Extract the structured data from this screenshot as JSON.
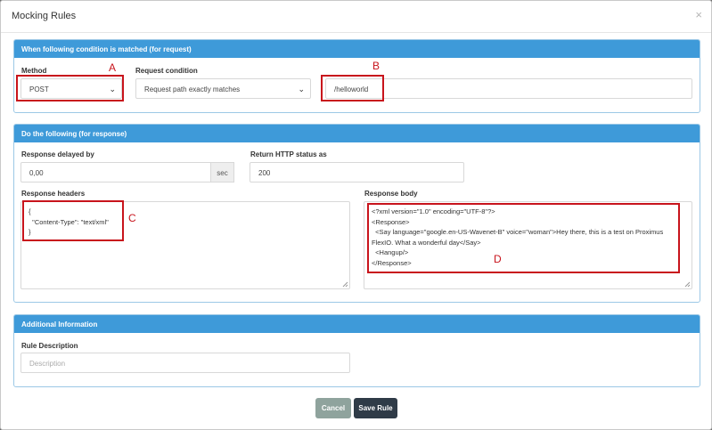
{
  "modal": {
    "title": "Mocking Rules",
    "close_glyph": "×"
  },
  "request_section": {
    "title": "When following condition is matched (for request)",
    "method_label": "Method",
    "method_value": "POST",
    "condition_label": "Request condition",
    "condition_value": "Request path exactly matches",
    "path_value": "/helloworld"
  },
  "response_section": {
    "title": "Do the following (for response)",
    "delay_label": "Response delayed by",
    "delay_value": "0,00",
    "delay_unit": "sec",
    "status_label": "Return HTTP status as",
    "status_value": "200",
    "headers_label": "Response headers",
    "headers_lines": [
      "{",
      "  \"Content-Type\": \"text/xml\"",
      "}"
    ],
    "body_label": "Response body",
    "body_lines": [
      "<?xml version=\"1.0\" encoding=\"UTF-8\"?>",
      "<Response>",
      "  <Say language=\"google.en-US-Wavenet-B\" voice=\"woman\">Hey there, this is a test on Proximus",
      "FlexIO. What a wonderful day</Say>",
      "  <Hangup/>",
      "</Response>"
    ]
  },
  "additional_section": {
    "title": "Additional Information",
    "description_label": "Rule Description",
    "description_placeholder": "Description"
  },
  "footer": {
    "cancel_label": "Cancel",
    "save_label": "Save Rule"
  },
  "annotations": {
    "a": "A",
    "b": "B",
    "c": "C",
    "d": "D"
  },
  "colors": {
    "panel_header": "#3e9ad9",
    "cancel_button": "#8fa39d",
    "save_button": "#2f3b47",
    "annotation_red": "#c8141c"
  }
}
